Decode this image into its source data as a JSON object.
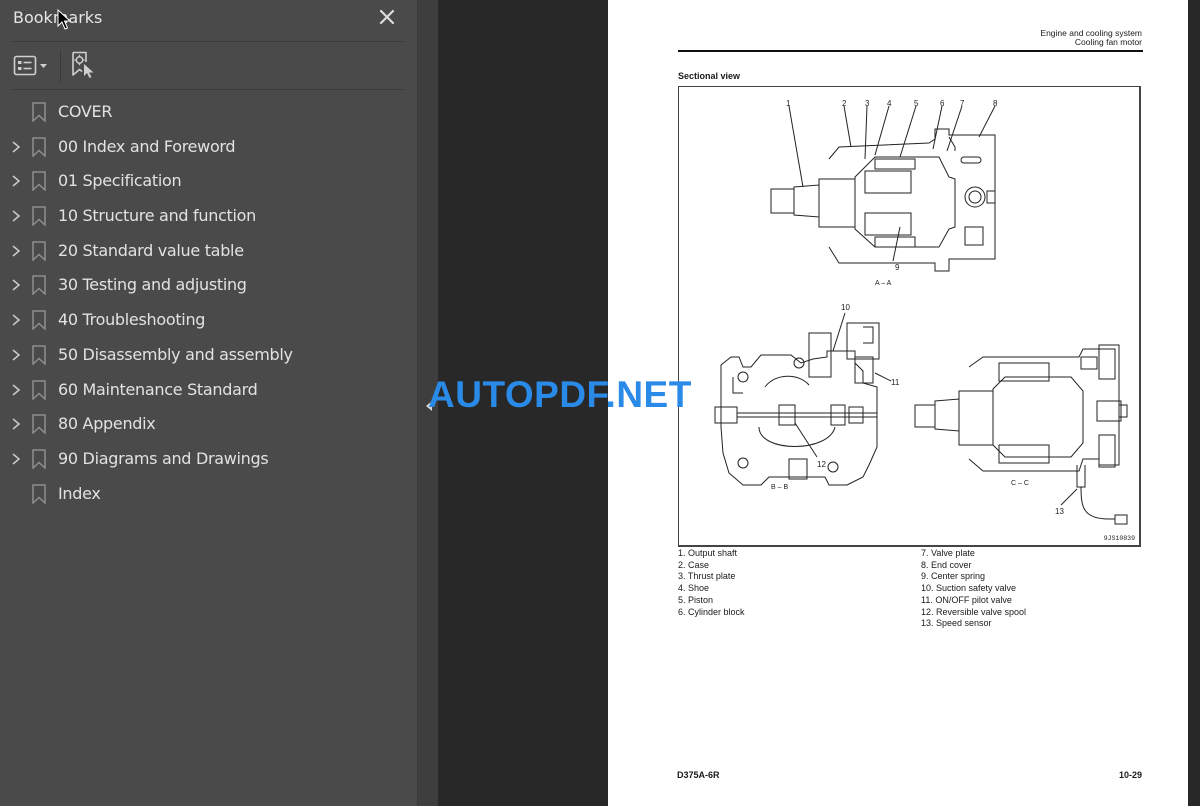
{
  "sidebar": {
    "title": "Bookmarks",
    "close_icon": "close-icon",
    "toolbar": {
      "options_icon": "list-options-icon",
      "find_bookmark_icon": "find-current-bookmark-icon"
    },
    "items": [
      {
        "label": "COVER",
        "expandable": false
      },
      {
        "label": "00 Index and Foreword",
        "expandable": true
      },
      {
        "label": "01 Specification",
        "expandable": true
      },
      {
        "label": "10 Structure and function",
        "expandable": true
      },
      {
        "label": "20 Standard value table",
        "expandable": true
      },
      {
        "label": "30 Testing and adjusting",
        "expandable": true
      },
      {
        "label": "40 Troubleshooting",
        "expandable": true
      },
      {
        "label": "50 Disassembly and assembly",
        "expandable": true
      },
      {
        "label": "60 Maintenance Standard",
        "expandable": true
      },
      {
        "label": "80 Appendix",
        "expandable": true
      },
      {
        "label": "90 Diagrams and Drawings",
        "expandable": true
      },
      {
        "label": "Index",
        "expandable": false
      }
    ]
  },
  "watermark": "AUTOPDF.NET",
  "page": {
    "header_line1": "Engine and cooling system",
    "header_line2": "Cooling fan motor",
    "section_title": "Sectional view",
    "figure": {
      "code": "9JS10839",
      "views": [
        "A – A",
        "B – B",
        "C – C"
      ],
      "callouts": [
        "1",
        "2",
        "3",
        "4",
        "5",
        "6",
        "7",
        "8",
        "9",
        "10",
        "11",
        "12",
        "13"
      ]
    },
    "parts_left": [
      "1.  Output shaft",
      "2.  Case",
      "3.  Thrust plate",
      "4.  Shoe",
      "5.  Piston",
      "6.  Cylinder block"
    ],
    "parts_right": [
      "7.  Valve plate",
      "8.  End cover",
      "9.  Center spring",
      "10. Suction safety valve",
      "11.  ON/OFF pilot valve",
      "12.  Reversible valve spool",
      "13. Speed sensor"
    ],
    "footer_model": "D375A-6R",
    "footer_page": "10-29"
  },
  "colors": {
    "sidebar_bg": "#4a4a4a",
    "viewer_bg": "#282828",
    "watermark": "#2a8ae8"
  }
}
